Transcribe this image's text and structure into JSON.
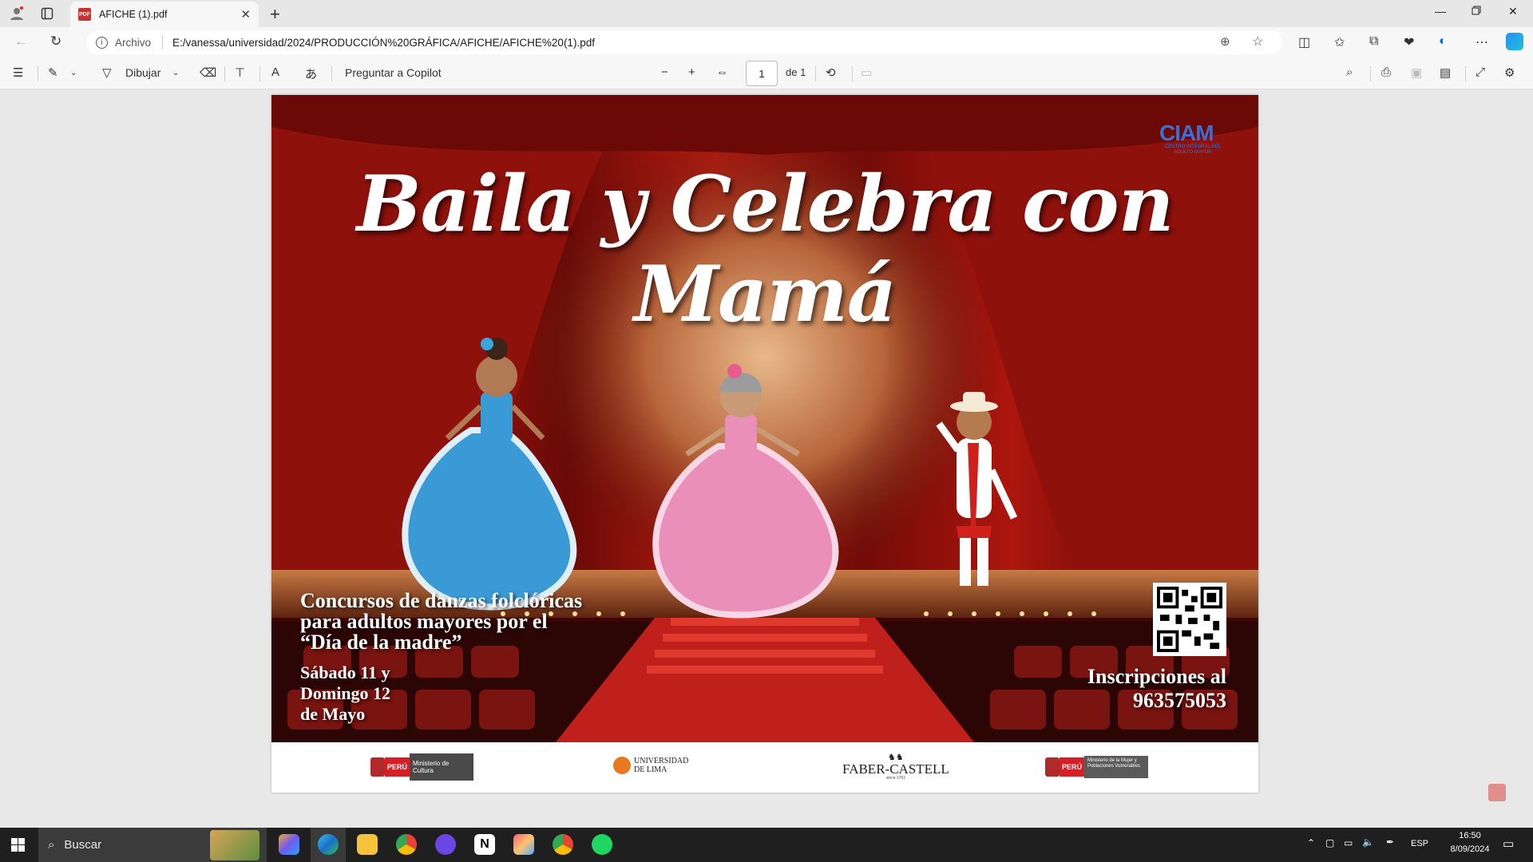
{
  "browser": {
    "tab_title": "AFICHE (1).pdf",
    "pdf_badge": "PDF",
    "address_label": "Archivo",
    "url": "E:/vanessa/universidad/2024/PRODUCCIÓN%20GRÁFICA/AFICHE/AFICHE%20(1).pdf"
  },
  "pdf_toolbar": {
    "draw_label": "Dibujar",
    "copilot_label": "Preguntar a Copilot",
    "page_current": "1",
    "page_total": "de 1"
  },
  "poster": {
    "title": "Baila y Celebra con Mamá",
    "ciam": "CIAM",
    "ciam_sub": "CENTRO INTEGRAL DEL ADULTO MAYOR",
    "contest_line1": "Concursos de danzas folclóricas",
    "contest_line2": "para adultos mayores por el",
    "contest_line3": "“Día de la madre”",
    "date_line1": "Sábado 11 y",
    "date_line2": "Domingo 12",
    "date_line3": "de Mayo",
    "inscription_line1": "Inscripciones al",
    "inscription_line2": "963575053"
  },
  "logos": {
    "peru1": "PERÚ",
    "ministerio_cultura": "Ministerio de Cultura",
    "ulima_line1": "UNIVERSIDAD",
    "ulima_line2": "DE LIMA",
    "faber": "FABER-CASTELL",
    "faber_sub": "since 1761",
    "peru2": "PERÚ",
    "ministerio_mujer": "Ministerio de la Mujer y Poblaciones Vulnerables"
  },
  "taskbar": {
    "search_placeholder": "Buscar",
    "lang": "ESP",
    "time": "16:50",
    "date": "8/09/2024"
  },
  "colors": {
    "curtain": "#9e1410",
    "stage_floor": "#6b2a12",
    "carpet": "#c0201c",
    "ciam_blue": "#3c6fd6",
    "accent_edge": "#0c6bd6"
  }
}
